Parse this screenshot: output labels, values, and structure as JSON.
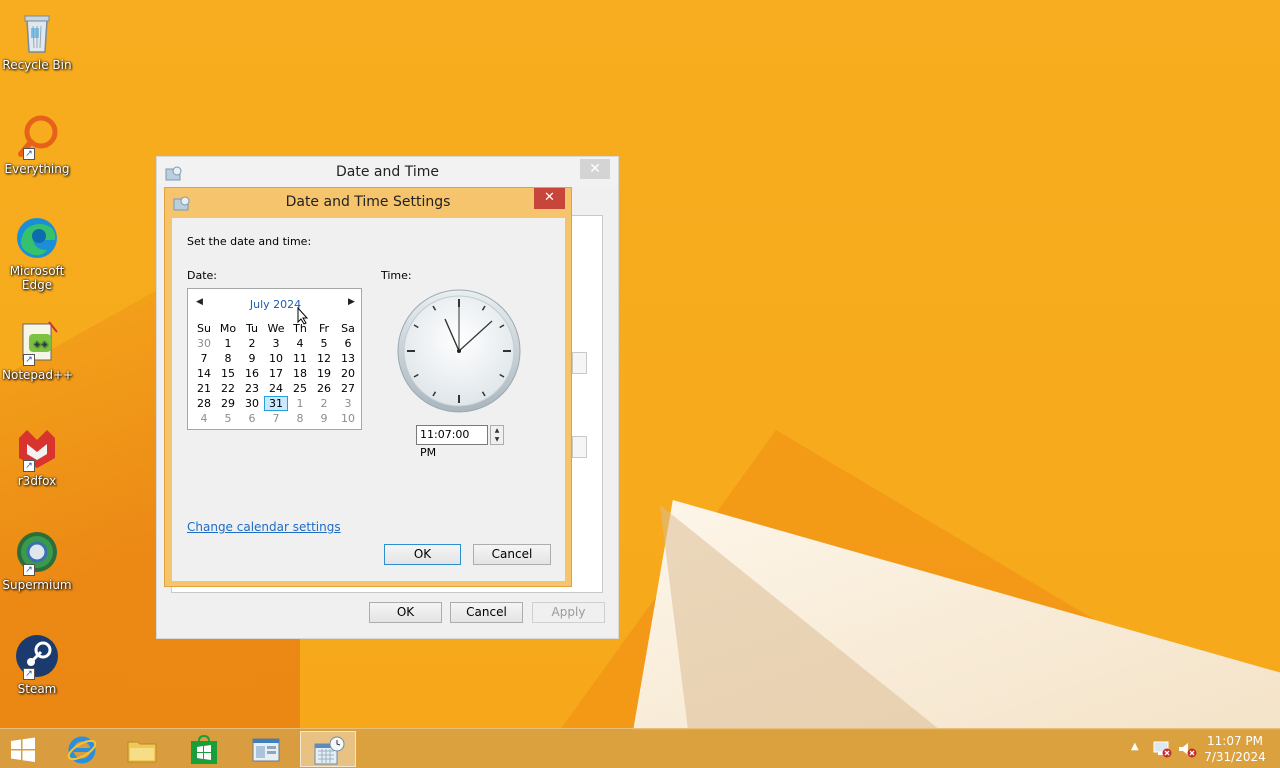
{
  "desktop": {
    "icons": [
      {
        "label": "Recycle Bin",
        "name": "recycle-bin-icon"
      },
      {
        "label": "Everything",
        "name": "everything-icon"
      },
      {
        "label": "Microsoft\nEdge",
        "name": "edge-icon"
      },
      {
        "label": "Notepad++",
        "name": "notepadpp-icon"
      },
      {
        "label": "r3dfox",
        "name": "r3dfox-icon"
      },
      {
        "label": "Supermium",
        "name": "supermium-icon"
      },
      {
        "label": "Steam",
        "name": "steam-icon"
      }
    ]
  },
  "outer_window": {
    "title": "Date and Time",
    "ok": "OK",
    "cancel": "Cancel",
    "apply": "Apply"
  },
  "dialog": {
    "title": "Date and Time Settings",
    "instruction": "Set the date and time:",
    "date_label": "Date:",
    "time_label": "Time:",
    "calendar": {
      "month_title": "July 2024",
      "weekdays": [
        "Su",
        "Mo",
        "Tu",
        "We",
        "Th",
        "Fr",
        "Sa"
      ],
      "weeks": [
        [
          "30",
          "1",
          "2",
          "3",
          "4",
          "5",
          "6"
        ],
        [
          "7",
          "8",
          "9",
          "10",
          "11",
          "12",
          "13"
        ],
        [
          "14",
          "15",
          "16",
          "17",
          "18",
          "19",
          "20"
        ],
        [
          "21",
          "22",
          "23",
          "24",
          "25",
          "26",
          "27"
        ],
        [
          "28",
          "29",
          "30",
          "31",
          "1",
          "2",
          "3"
        ],
        [
          "4",
          "5",
          "6",
          "7",
          "8",
          "9",
          "10"
        ]
      ],
      "selected": "31"
    },
    "time_value": "11:07:00 PM",
    "change_calendar_link": "Change calendar settings",
    "ok": "OK",
    "cancel": "Cancel"
  },
  "taskbar": {
    "clock_time": "11:07 PM",
    "clock_date": "7/31/2024"
  },
  "colors": {
    "wallpaper": "#f7ad1f",
    "dialog_frame": "#f5c46c",
    "close_red": "#c7453a",
    "link": "#1e6cc6"
  }
}
